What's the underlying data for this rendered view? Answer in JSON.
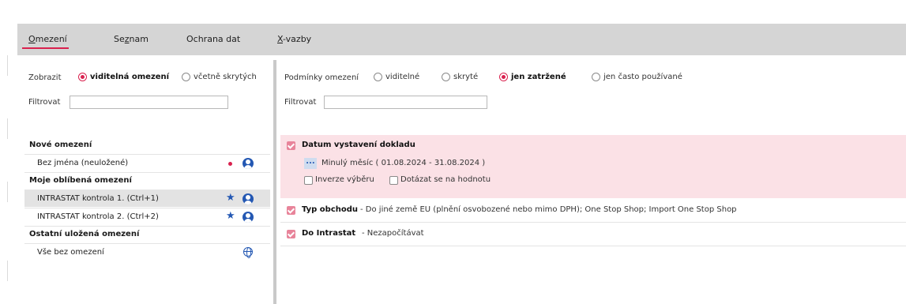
{
  "tabs": [
    {
      "pre": "",
      "u": "O",
      "post": "mezení"
    },
    {
      "pre": "Se",
      "u": "z",
      "post": "nam"
    },
    {
      "pre": "Ochrana dat",
      "u": "",
      "post": ""
    },
    {
      "pre": "",
      "u": "X",
      "post": "-vazby"
    }
  ],
  "left": {
    "show_label": "Zobrazit",
    "show_visible": "viditelná omezení",
    "show_hidden": "včetně skrytých",
    "filter_label": "Filtrovat",
    "filter_value": "",
    "new_header": "Nové omezení",
    "new_item": "Bez jména (neuložené)",
    "fav_header": "Moje oblíbená omezení",
    "fav_items": [
      "INTRASTAT kontrola 1. (Ctrl+1)",
      "INTRASTAT kontrola 2. (Ctrl+2)"
    ],
    "other_header": "Ostatní uložená omezení",
    "other_item": "Vše bez omezení"
  },
  "right": {
    "conditions_label": "Podmínky omezení",
    "radio_visible": "viditelné",
    "radio_hidden": "skryté",
    "radio_checked": "jen zatržené",
    "radio_frequent": "jen často používané",
    "filter_label": "Filtrovat",
    "filter_value": "",
    "cond1": {
      "title": "Datum vystavení dokladu",
      "dots": "...",
      "value": "Minulý měsíc ( 01.08.2024 - 31.08.2024 )",
      "invert": "Inverze výběru",
      "ask": "Dotázat se na hodnotu"
    },
    "cond2": {
      "title": "Typ obchodu",
      "value": "- Do jiné země EU (plnění osvobozené nebo mimo DPH); One Stop Shop; Import One Stop Shop"
    },
    "cond3": {
      "title": "Do Intrastat",
      "value": "- Nezapočítávat"
    }
  },
  "colors": {
    "accent": "#d9214e",
    "icon_blue": "#2458b3",
    "expanded_bg": "#fbe1e6",
    "tabbar_bg": "#d5d5d5"
  },
  "icons": [
    "star-icon",
    "user-circle-icon",
    "globe-icon",
    "red-dot-icon",
    "checkbox-checked-icon"
  ]
}
